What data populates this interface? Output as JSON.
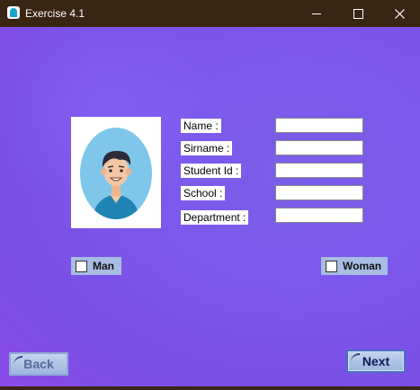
{
  "window": {
    "title": "Exercise 4.1",
    "controls": {
      "minimize": "minimize",
      "maximize": "maximize",
      "close": "close"
    }
  },
  "form": {
    "fields": [
      {
        "label": "Name :",
        "value": ""
      },
      {
        "label": "Sirname :",
        "value": ""
      },
      {
        "label": "Student Id :",
        "value": ""
      },
      {
        "label": "School :",
        "value": ""
      },
      {
        "label": "Department :",
        "value": ""
      }
    ],
    "gender": {
      "man_label": "Man",
      "man_checked": false,
      "woman_label": "Woman",
      "woman_checked": false
    },
    "buttons": {
      "back_label": "Back",
      "next_label": "Next"
    }
  },
  "colors": {
    "titlebar": "#3a2412",
    "background": "#7d58ec",
    "checkbox_panel": "#a7bde3",
    "button_face": "#b2c6e6"
  },
  "icons": {
    "app": "app-icon",
    "avatar": "user-avatar-illustration"
  }
}
